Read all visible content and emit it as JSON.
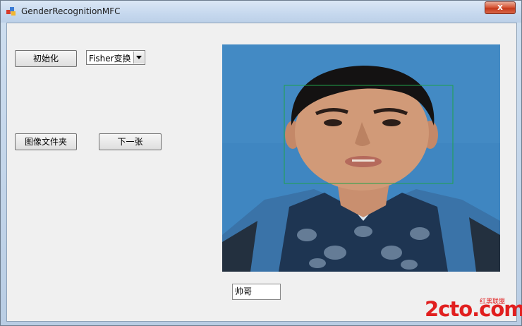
{
  "window": {
    "title": "GenderRecognitionMFC",
    "close_glyph": "x"
  },
  "controls": {
    "init_button": "初始化",
    "method_select": "Fisher变换",
    "folder_button": "图像文件夹",
    "next_button": "下一张"
  },
  "result": {
    "label": "帅哥"
  },
  "watermark": {
    "main": "2cto.com",
    "sub": "红黑联盟"
  },
  "colors": {
    "face_box": "#1fa34a",
    "photo_background": "#3f86c1",
    "watermark": "#e11f1f"
  }
}
